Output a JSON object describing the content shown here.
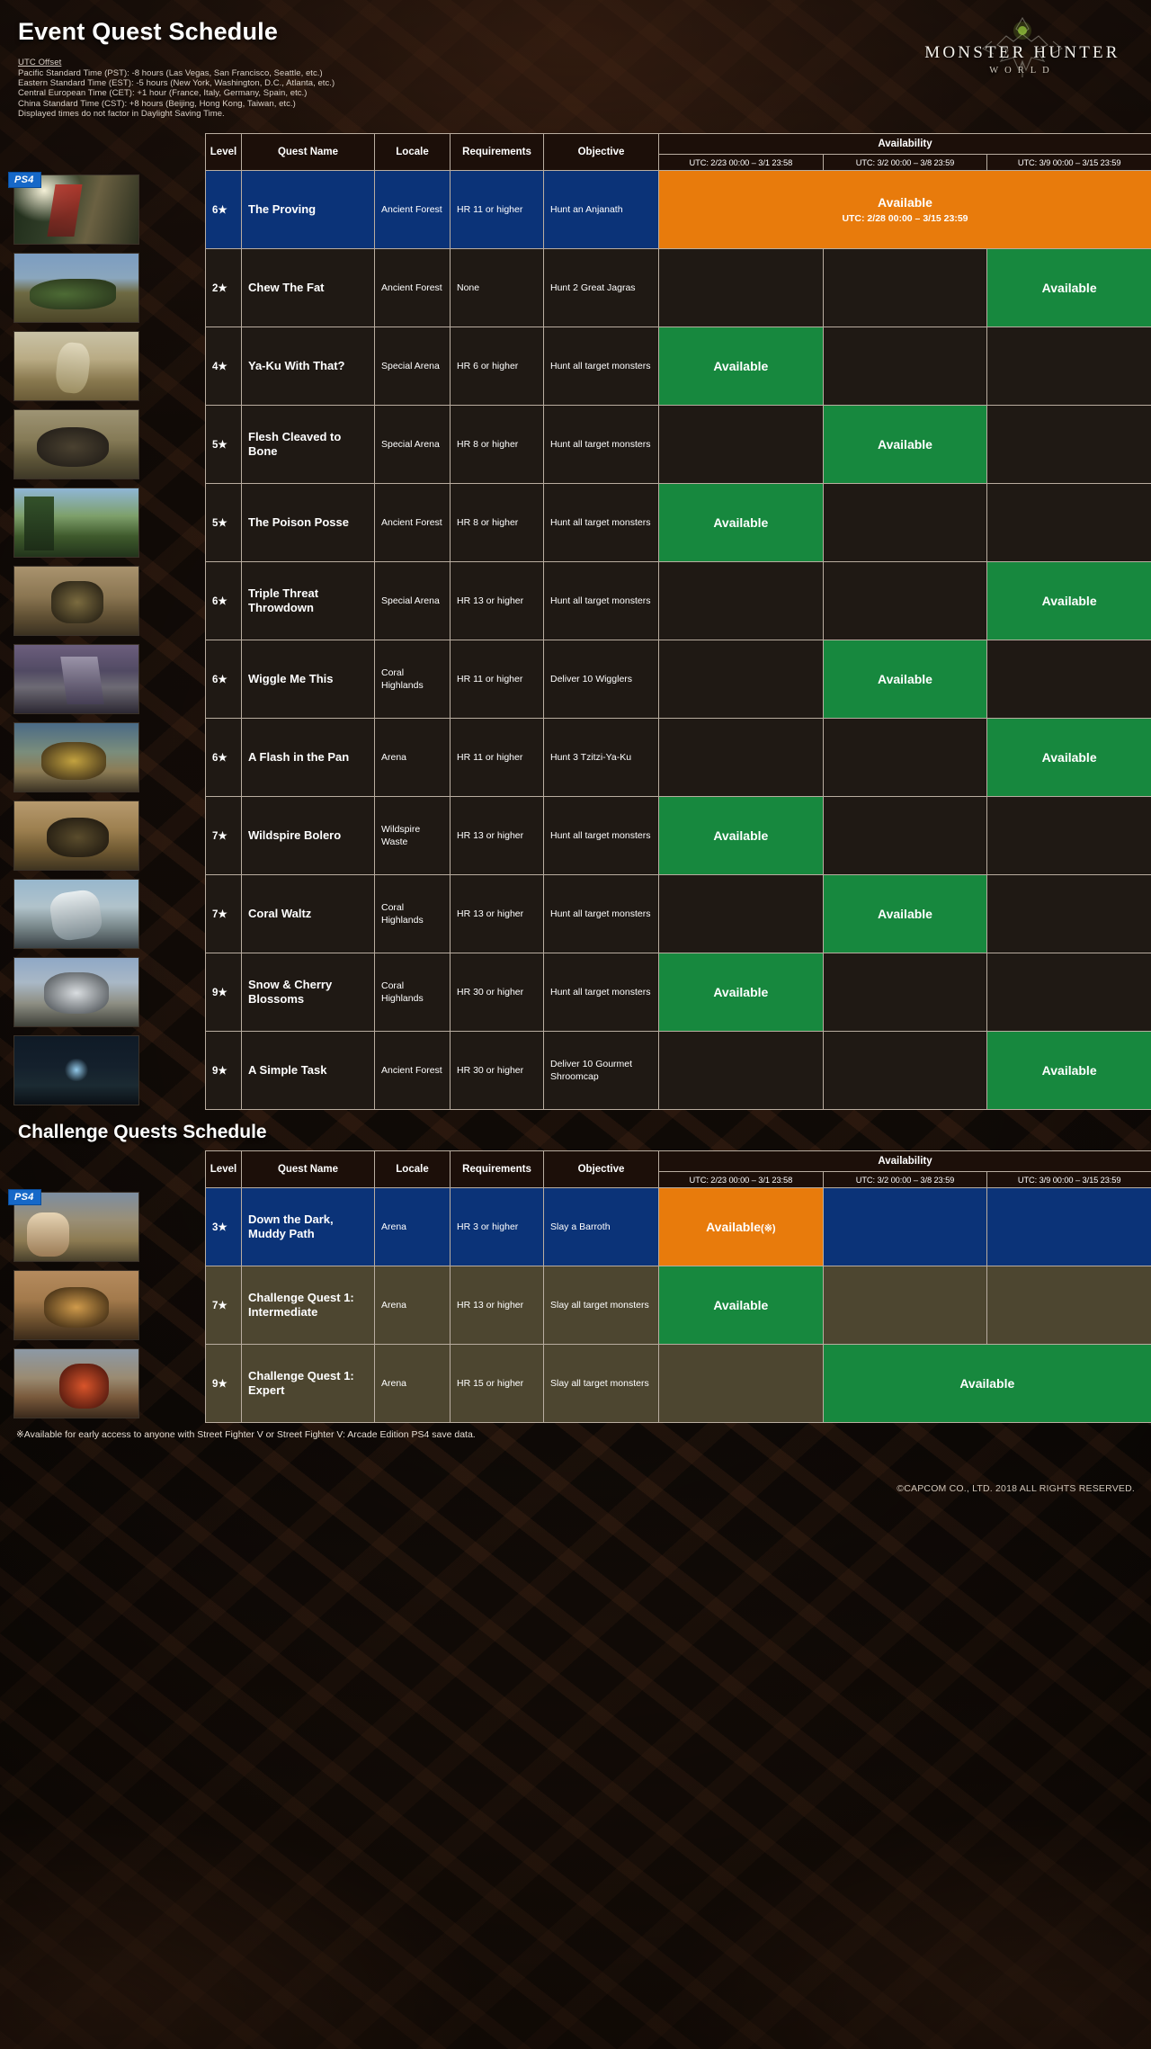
{
  "header": {
    "title": "Event Quest Schedule",
    "utc_heading": "UTC Offset",
    "utc_lines": [
      "Pacific Standard Time (PST): -8 hours (Las Vegas, San Francisco, Seattle, etc.)",
      "Eastern Standard Time (EST): -5 hours (New York, Washington, D.C., Atlanta, etc.)",
      "Central European Time (CET): +1 hour (France, Italy, Germany, Spain, etc.)",
      "China Standard Time (CST): +8 hours (Beijing, Hong Kong, Taiwan, etc.)",
      "Displayed times do not factor in Daylight Saving Time."
    ],
    "logo_main": "MONSTER HUNTER",
    "logo_sub": "WORLD"
  },
  "columns": {
    "level": "Level",
    "quest_name": "Quest Name",
    "locale": "Locale",
    "requirements": "Requirements",
    "objective": "Objective",
    "availability": "Availability",
    "period_1": "UTC: 2/23 00:00 – 3/1 23:58",
    "period_2": "UTC: 3/2 00:00 – 3/8 23:59",
    "period_3": "UTC: 3/9 00:00 – 3/15 23:59"
  },
  "labels": {
    "available": "Available",
    "available_note_mark": "(※)",
    "ps4_badge": "PS4"
  },
  "event_section": {
    "title": "Event Quest Schedule",
    "rows": [
      {
        "level": "6★",
        "name": "The Proving",
        "locale": "Ancient Forest",
        "requirements": "HR 11 or higher",
        "objective": "Hunt an Anjanath",
        "row_style": "blue",
        "badge": "PS4",
        "art": "a1",
        "availability": [
          {
            "span": 3,
            "state": "orange",
            "label": "Available",
            "sub": "UTC: 2/28 00:00 – 3/15 23:59"
          }
        ]
      },
      {
        "level": "2★",
        "name": "Chew The Fat",
        "locale": "Ancient Forest",
        "requirements": "None",
        "objective": "Hunt 2 Great Jagras",
        "row_style": "dark",
        "art": "a2",
        "availability": [
          {
            "span": 1,
            "state": "empty",
            "label": ""
          },
          {
            "span": 1,
            "state": "empty",
            "label": ""
          },
          {
            "span": 1,
            "state": "green",
            "label": "Available"
          }
        ]
      },
      {
        "level": "4★",
        "name": "Ya-Ku With That?",
        "locale": "Special Arena",
        "requirements": "HR 6 or higher",
        "objective": "Hunt all target monsters",
        "row_style": "dark",
        "art": "a3",
        "availability": [
          {
            "span": 1,
            "state": "green",
            "label": "Available"
          },
          {
            "span": 1,
            "state": "empty",
            "label": ""
          },
          {
            "span": 1,
            "state": "empty",
            "label": ""
          }
        ]
      },
      {
        "level": "5★",
        "name": "Flesh Cleaved to Bone",
        "locale": "Special Arena",
        "requirements": "HR 8 or higher",
        "objective": "Hunt all target monsters",
        "row_style": "dark",
        "art": "a4",
        "availability": [
          {
            "span": 1,
            "state": "empty",
            "label": ""
          },
          {
            "span": 1,
            "state": "green",
            "label": "Available"
          },
          {
            "span": 1,
            "state": "empty",
            "label": ""
          }
        ]
      },
      {
        "level": "5★",
        "name": "The Poison Posse",
        "locale": "Ancient Forest",
        "requirements": "HR 8 or higher",
        "objective": "Hunt all target monsters",
        "row_style": "dark",
        "art": "a5",
        "availability": [
          {
            "span": 1,
            "state": "green",
            "label": "Available"
          },
          {
            "span": 1,
            "state": "empty",
            "label": ""
          },
          {
            "span": 1,
            "state": "empty",
            "label": ""
          }
        ]
      },
      {
        "level": "6★",
        "name": "Triple Threat Throwdown",
        "locale": "Special Arena",
        "requirements": "HR 13 or higher",
        "objective": "Hunt all target monsters",
        "row_style": "dark",
        "art": "a6",
        "availability": [
          {
            "span": 1,
            "state": "empty",
            "label": ""
          },
          {
            "span": 1,
            "state": "empty",
            "label": ""
          },
          {
            "span": 1,
            "state": "green",
            "label": "Available"
          }
        ]
      },
      {
        "level": "6★",
        "name": "Wiggle Me This",
        "locale": "Coral Highlands",
        "requirements": "HR 11 or higher",
        "objective": "Deliver 10 Wigglers",
        "row_style": "dark",
        "art": "a7",
        "availability": [
          {
            "span": 1,
            "state": "empty",
            "label": ""
          },
          {
            "span": 1,
            "state": "green",
            "label": "Available"
          },
          {
            "span": 1,
            "state": "empty",
            "label": ""
          }
        ]
      },
      {
        "level": "6★",
        "name": "A Flash in the Pan",
        "locale": "Arena",
        "requirements": "HR 11 or higher",
        "objective": "Hunt 3 Tzitzi-Ya-Ku",
        "row_style": "dark",
        "art": "a8",
        "availability": [
          {
            "span": 1,
            "state": "empty",
            "label": ""
          },
          {
            "span": 1,
            "state": "empty",
            "label": ""
          },
          {
            "span": 1,
            "state": "green",
            "label": "Available"
          }
        ]
      },
      {
        "level": "7★",
        "name": "Wildspire Bolero",
        "locale": "Wildspire Waste",
        "requirements": "HR 13 or higher",
        "objective": "Hunt all target monsters",
        "row_style": "dark",
        "art": "a9",
        "availability": [
          {
            "span": 1,
            "state": "green",
            "label": "Available"
          },
          {
            "span": 1,
            "state": "empty",
            "label": ""
          },
          {
            "span": 1,
            "state": "empty",
            "label": ""
          }
        ]
      },
      {
        "level": "7★",
        "name": "Coral Waltz",
        "locale": "Coral Highlands",
        "requirements": "HR 13 or higher",
        "objective": "Hunt all target monsters",
        "row_style": "dark",
        "art": "a10",
        "availability": [
          {
            "span": 1,
            "state": "empty",
            "label": ""
          },
          {
            "span": 1,
            "state": "green",
            "label": "Available"
          },
          {
            "span": 1,
            "state": "empty",
            "label": ""
          }
        ]
      },
      {
        "level": "9★",
        "name": "Snow & Cherry Blossoms",
        "locale": "Coral Highlands",
        "requirements": "HR 30 or higher",
        "objective": "Hunt all target monsters",
        "row_style": "dark",
        "art": "a11",
        "availability": [
          {
            "span": 1,
            "state": "green",
            "label": "Available"
          },
          {
            "span": 1,
            "state": "empty",
            "label": ""
          },
          {
            "span": 1,
            "state": "empty",
            "label": ""
          }
        ]
      },
      {
        "level": "9★",
        "name": "A Simple Task",
        "locale": "Ancient Forest",
        "requirements": "HR 30 or higher",
        "objective": "Deliver 10 Gourmet Shroomcap",
        "row_style": "dark",
        "art": "a12",
        "availability": [
          {
            "span": 1,
            "state": "empty",
            "label": ""
          },
          {
            "span": 1,
            "state": "empty",
            "label": ""
          },
          {
            "span": 1,
            "state": "green",
            "label": "Available"
          }
        ]
      }
    ]
  },
  "challenge_section": {
    "title": "Challenge Quests Schedule",
    "rows": [
      {
        "level": "3★",
        "name": "Down the Dark, Muddy Path",
        "locale": "Arena",
        "requirements": "HR 3 or higher",
        "objective": "Slay a Barroth",
        "row_style": "blue",
        "badge": "PS4",
        "art": "a13",
        "availability": [
          {
            "span": 1,
            "state": "orange",
            "label": "Available",
            "mark": "(※)"
          },
          {
            "span": 1,
            "state": "empty",
            "label": ""
          },
          {
            "span": 1,
            "state": "empty",
            "label": ""
          }
        ]
      },
      {
        "level": "7★",
        "name": "Challenge Quest 1: Intermediate",
        "locale": "Arena",
        "requirements": "HR 13 or higher",
        "objective": "Slay all target monsters",
        "row_style": "olive",
        "art": "a14",
        "availability": [
          {
            "span": 1,
            "state": "green",
            "label": "Available"
          },
          {
            "span": 1,
            "state": "empty",
            "label": ""
          },
          {
            "span": 1,
            "state": "empty",
            "label": ""
          }
        ]
      },
      {
        "level": "9★",
        "name": "Challenge Quest 1: Expert",
        "locale": "Arena",
        "requirements": "HR 15 or higher",
        "objective": "Slay all target monsters",
        "row_style": "olive",
        "art": "a15",
        "availability": [
          {
            "span": 1,
            "state": "empty",
            "label": ""
          },
          {
            "span": 2,
            "state": "green",
            "label": "Available"
          }
        ]
      }
    ]
  },
  "footnote": "※Available for early access to anyone with Street Fighter V or Street Fighter V: Arcade Edition PS4 save data.",
  "footer": "©CAPCOM CO., LTD. 2018 ALL RIGHTS RESERVED.",
  "colors": {
    "available_green": "#17883e",
    "available_orange": "#e87b0c",
    "row_blue": "#0b3378",
    "row_dark": "#1f1914",
    "row_olive": "#4d4630",
    "ps4_blue": "#1668c8"
  }
}
